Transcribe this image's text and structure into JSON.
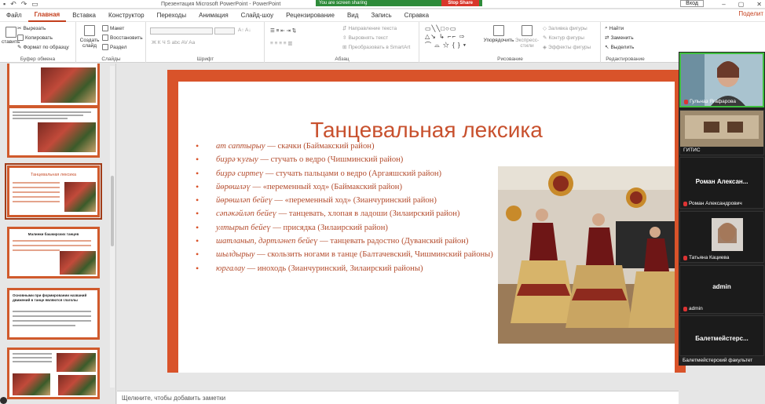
{
  "window": {
    "title": "Презентация Microsoft PowerPoint  -  PowerPoint",
    "signin": "Вход",
    "share_banner": {
      "text": "You are screen sharing",
      "stop": "Stop Share"
    }
  },
  "ribbon_tabs": [
    "Файл",
    "Главная",
    "Вставка",
    "Конструктор",
    "Переходы",
    "Анимация",
    "Слайд-шоу",
    "Рецензирование",
    "Вид",
    "Запись",
    "Справка"
  ],
  "active_tab": "Главная",
  "share_button": "Поделит",
  "ribbon": {
    "clipboard": {
      "paste": "ставить",
      "cut": "Вырезать",
      "copy": "Копировать",
      "format_painter": "Формат по образцу",
      "label": "Буфер обмена"
    },
    "slides": {
      "new_slide": "Создать слайд",
      "layout": "Макет",
      "reset": "Восстановить",
      "section": "Раздел",
      "label": "Слайды"
    },
    "font": {
      "label": "Шрифт"
    },
    "paragraph": {
      "text_direction": "Направление текста",
      "align_text": "Выровнять текст",
      "smartart": "Преобразовать в SmartArt",
      "label": "Абзац"
    },
    "drawing": {
      "arrange": "Упорядочить",
      "quick_styles": "Экспресс-стили",
      "fill": "Заливка фигуры",
      "outline": "Контур фигуры",
      "effects": "Эффекты фигуры",
      "label": "Рисование"
    },
    "editing": {
      "find": "Найти",
      "replace": "Заменить",
      "select": "Выделить",
      "label": "Редактирование"
    }
  },
  "thumbnails": [
    {
      "number": "",
      "title": ""
    },
    {
      "number": "",
      "title": ""
    },
    {
      "number": "",
      "title": "Танцевальная лексика"
    },
    {
      "number": "",
      "title": "Малинки башкирских танцев"
    },
    {
      "number": "",
      "title": "Основными при формировании названий движений в танце являются глаголы"
    },
    {
      "number": "",
      "title": ""
    }
  ],
  "slide": {
    "title": "Танцевальная лексика",
    "bullets": [
      {
        "term": "ат саптырыу",
        "rest": " — скачки (Баймакский район)"
      },
      {
        "term": "биҙрә ҡуғыу",
        "rest": " — стучать о ведро (Чишминский район)"
      },
      {
        "term": "биҙрә сиртеү",
        "rest": " — стучать пальцами о ведро (Аргаяшский район)"
      },
      {
        "term": "йөрөшләү",
        "rest": " — «переменный ход» (Баймакский район)"
      },
      {
        "term": "йөрөшләп бейеү",
        "rest": " — «переменный ход» (Зианчуринский район)"
      },
      {
        "term": "сәпәкәйләп бейеү",
        "rest": " — танцевать, хлопая в ладоши (Зилаирский район)"
      },
      {
        "term": "ултырып бейеү",
        "rest": " — присядка (Зилаирский район)"
      },
      {
        "term": "шатланып, дәртләнеп бейеү",
        "rest": " — танцевать радостно (Дуванский район)"
      },
      {
        "term": "шылдырыу",
        "rest": " — скользить ногами в танце (Балтачевский, Чишминский районы)"
      },
      {
        "term": "юргалау",
        "rest": " — иноходь (Зианчуринский, Зилаирский районы)"
      }
    ]
  },
  "notes_placeholder": "Щелкните, чтобы добавить заметки",
  "participants": [
    {
      "name": "Гульназ Ягафарова"
    },
    {
      "name": "ГИТИС"
    },
    {
      "display": "Роман  Алексан...",
      "name": "Роман Александрович"
    },
    {
      "name": "Татьяна Кациева"
    },
    {
      "display": "admin",
      "name": "admin"
    },
    {
      "display": "Балетмейстерс...",
      "name": "Балетмейстерский факультет"
    }
  ]
}
